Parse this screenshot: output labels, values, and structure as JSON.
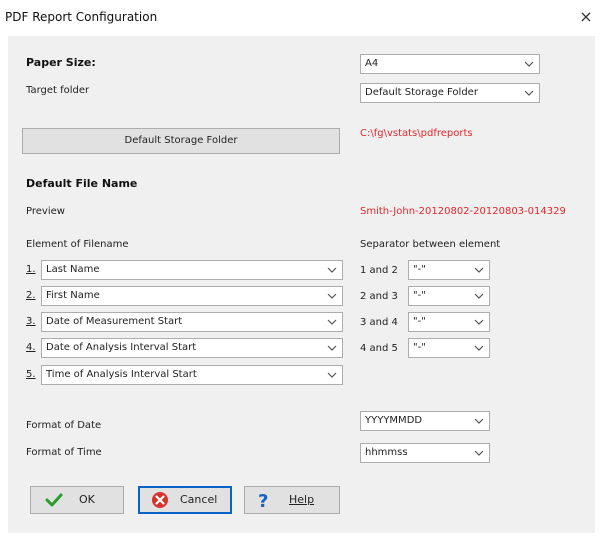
{
  "window": {
    "title": "PDF Report Configuration",
    "close_glyph": "×"
  },
  "paper_size": {
    "label": "Paper Size:",
    "value": "A4"
  },
  "target_folder": {
    "label": "Target folder",
    "value": "Default Storage Folder"
  },
  "default_storage_button": {
    "label": "Default Storage Folder"
  },
  "storage_path": "C:\\fg\\vstats\\pdfreports",
  "file_name": {
    "heading": "Default File Name",
    "preview_label": "Preview",
    "preview_value": "Smith-John-20120802-20120803-014329"
  },
  "elements": {
    "heading": "Element of Filename",
    "items": [
      {
        "num": "1.",
        "value": "Last Name"
      },
      {
        "num": "2.",
        "value": "First Name"
      },
      {
        "num": "3.",
        "value": "Date of Measurement Start"
      },
      {
        "num": "4.",
        "value": "Date of Analysis Interval Start"
      },
      {
        "num": "5.",
        "value": "Time of Analysis Interval Start"
      }
    ]
  },
  "separators": {
    "heading": "Separator between element",
    "items": [
      {
        "label": "1 and 2",
        "value": "\"-\""
      },
      {
        "label": "2 and 3",
        "value": "\"-\""
      },
      {
        "label": "3 and 4",
        "value": "\"-\""
      },
      {
        "label": "4 and 5",
        "value": "\"-\""
      }
    ]
  },
  "format_date": {
    "label": "Format of Date",
    "value": "YYYYMMDD"
  },
  "format_time": {
    "label": "Format of Time",
    "value": "hhmmss"
  },
  "buttons": {
    "ok": "OK",
    "cancel": "Cancel",
    "help": "Help"
  },
  "colors": {
    "path_red": "#e0282e",
    "ok_green": "#2a9d2a",
    "cancel_red": "#d9322c",
    "help_blue": "#1a5fc4",
    "focus_blue": "#0a64c8"
  }
}
